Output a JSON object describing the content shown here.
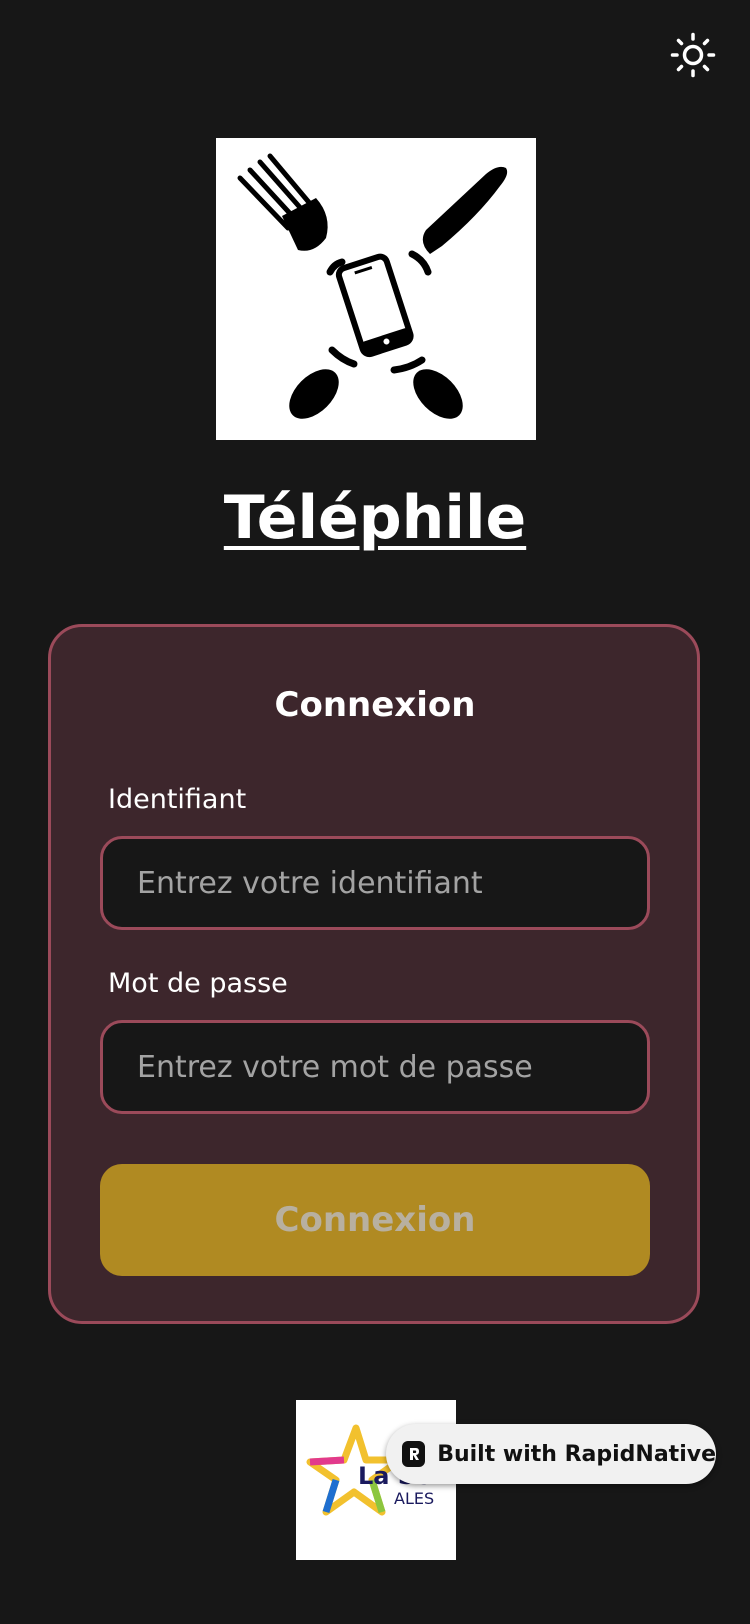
{
  "header": {
    "theme_toggle_icon": "sun-icon"
  },
  "brand": {
    "logo_icon": "fork-knife-phone-logo",
    "app_name": "Téléphile"
  },
  "login_card": {
    "title": "Connexion",
    "username": {
      "label": "Identifiant",
      "placeholder": "Entrez votre identifiant",
      "value": ""
    },
    "password": {
      "label": "Mot de passe",
      "placeholder": "Entrez votre mot de passe",
      "value": ""
    },
    "submit_label": "Connexion"
  },
  "footer": {
    "partner_logo_text": "La Sc... ALES",
    "badge_label": "Built with RapidNative"
  },
  "colors": {
    "background": "#171717",
    "card_background": "#3d262c",
    "card_border": "#9b4a5a",
    "button": "#b08a22"
  }
}
